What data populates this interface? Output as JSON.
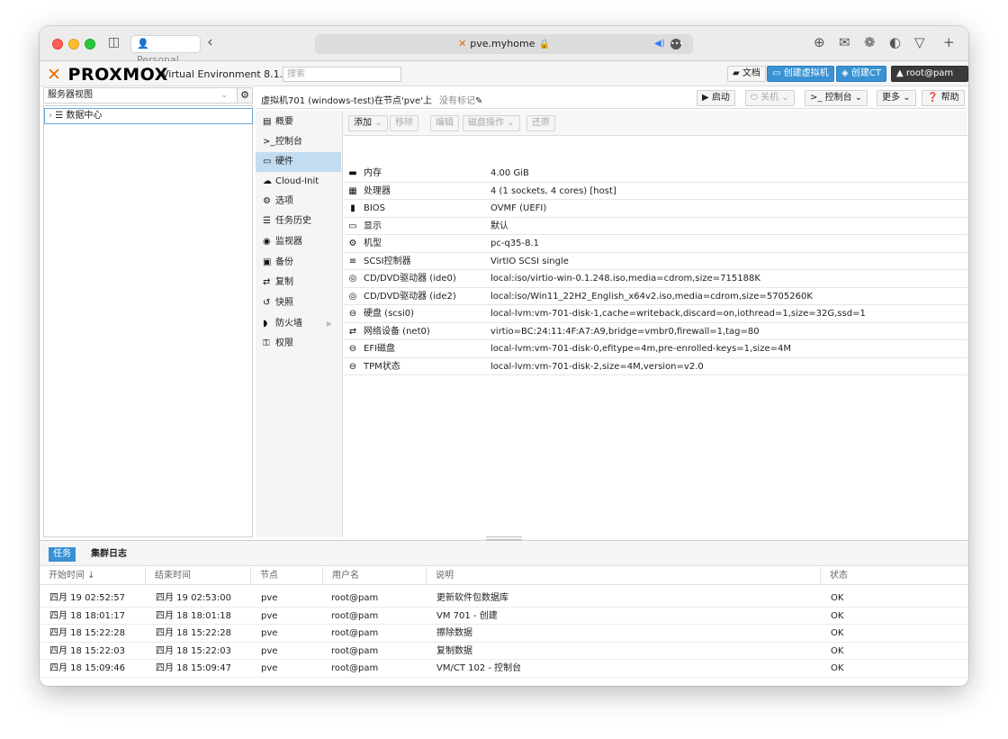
{
  "browser": {
    "profile": "Personal",
    "url": "pve.myhome",
    "icons": {
      "sidebar": "sidebar-icon",
      "back": "back-arrow-icon",
      "download": "download-icon",
      "extensions": [
        "ext-icon-1",
        "ext-icon-2",
        "ext-icon-3",
        "ext-icon-4"
      ],
      "new_tab": "plus-icon"
    }
  },
  "header": {
    "logo_text": "PROXMOX",
    "version": "Virtual Environment 8.1.10",
    "search_placeholder": "搜索",
    "docs": "文档",
    "create_vm": "创建虚拟机",
    "create_ct": "创建CT",
    "user": "root@pam"
  },
  "left": {
    "view_select": "服务器视图",
    "tree_root": "数据中心"
  },
  "main": {
    "title": "虚拟机701 (windows-test)在节点'pve'上",
    "tags": "没有标记",
    "start": "启动",
    "shutdown": "关机",
    "console": "控制台",
    "more": "更多",
    "help": "帮助"
  },
  "nav": [
    {
      "label": "概要",
      "icon": "summary-icon",
      "glyph": "▤"
    },
    {
      "label": "控制台",
      "icon": "console-icon",
      "glyph": ">_"
    },
    {
      "label": "硬件",
      "icon": "hardware-icon",
      "glyph": "▭",
      "selected": true
    },
    {
      "label": "Cloud-Init",
      "icon": "cloud-icon",
      "glyph": "☁"
    },
    {
      "label": "选项",
      "icon": "gear-icon",
      "glyph": "⚙"
    },
    {
      "label": "任务历史",
      "icon": "task-history-icon",
      "glyph": "☰"
    },
    {
      "label": "监视器",
      "icon": "eye-icon",
      "glyph": "◉"
    },
    {
      "label": "备份",
      "icon": "save-icon",
      "glyph": "▣"
    },
    {
      "label": "复制",
      "icon": "replication-icon",
      "glyph": "⇄"
    },
    {
      "label": "快照",
      "icon": "snapshot-icon",
      "glyph": "↺"
    },
    {
      "label": "防火墙",
      "icon": "shield-icon",
      "glyph": "◗",
      "has_submenu": true
    },
    {
      "label": "权限",
      "icon": "unlock-icon",
      "glyph": "🔓"
    }
  ],
  "toolbar": {
    "add": "添加",
    "remove": "移除",
    "edit": "编辑",
    "disk_action": "磁盘操作",
    "revert": "还原"
  },
  "hardware": [
    {
      "icon": "memory-icon",
      "glyph": "▬",
      "name": "内存",
      "value": "4.00 GiB"
    },
    {
      "icon": "cpu-icon",
      "glyph": "▦",
      "name": "处理器",
      "value": "4 (1 sockets, 4 cores) [host]"
    },
    {
      "icon": "bios-icon",
      "glyph": "▮",
      "name": "BIOS",
      "value": "OVMF (UEFI)"
    },
    {
      "icon": "display-icon",
      "glyph": "▭",
      "name": "显示",
      "value": "默认"
    },
    {
      "icon": "machine-icon",
      "glyph": "⚙",
      "name": "机型",
      "value": "pc-q35-8.1"
    },
    {
      "icon": "database-icon",
      "glyph": "≡",
      "name": "SCSI控制器",
      "value": "VirtIO SCSI single"
    },
    {
      "icon": "cdrom-icon",
      "glyph": "◎",
      "name": "CD/DVD驱动器 (ide0)",
      "value": "local:iso/virtio-win-0.1.248.iso,media=cdrom,size=715188K"
    },
    {
      "icon": "cdrom-icon",
      "glyph": "◎",
      "name": "CD/DVD驱动器 (ide2)",
      "value": "local:iso/Win11_22H2_English_x64v2.iso,media=cdrom,size=5705260K"
    },
    {
      "icon": "hdd-icon",
      "glyph": "⊖",
      "name": "硬盘 (scsi0)",
      "value": "local-lvm:vm-701-disk-1,cache=writeback,discard=on,iothread=1,size=32G,ssd=1"
    },
    {
      "icon": "network-icon",
      "glyph": "⇄",
      "name": "网络设备 (net0)",
      "value": "virtio=BC:24:11:4F:A7:A9,bridge=vmbr0,firewall=1,tag=80"
    },
    {
      "icon": "hdd-icon",
      "glyph": "⊖",
      "name": "EFI磁盘",
      "value": "local-lvm:vm-701-disk-0,efitype=4m,pre-enrolled-keys=1,size=4M"
    },
    {
      "icon": "hdd-icon",
      "glyph": "⊖",
      "name": "TPM状态",
      "value": "local-lvm:vm-701-disk-2,size=4M,version=v2.0"
    }
  ],
  "bottom": {
    "tab_tasks": "任务",
    "tab_cluster_log": "集群日志",
    "columns": [
      "开始时间 ↓",
      "结束时间",
      "节点",
      "用户名",
      "说明",
      "状态"
    ],
    "rows": [
      [
        "四月 19 02:52:57",
        "四月 19 02:53:00",
        "pve",
        "root@pam",
        "更新软件包数据库",
        "OK"
      ],
      [
        "四月 18 18:01:17",
        "四月 18 18:01:18",
        "pve",
        "root@pam",
        "VM 701 - 创建",
        "OK"
      ],
      [
        "四月 18 15:22:28",
        "四月 18 15:22:28",
        "pve",
        "root@pam",
        "擦除数据",
        "OK"
      ],
      [
        "四月 18 15:22:03",
        "四月 18 15:22:03",
        "pve",
        "root@pam",
        "复制数据",
        "OK"
      ],
      [
        "四月 18 15:09:46",
        "四月 18 15:09:47",
        "pve",
        "root@pam",
        "VM/CT 102 - 控制台",
        "OK"
      ]
    ]
  },
  "colors": {
    "accent": "#3892d4",
    "proxmox_orange": "#e57000",
    "selected_nav": "#c2ddf2"
  }
}
